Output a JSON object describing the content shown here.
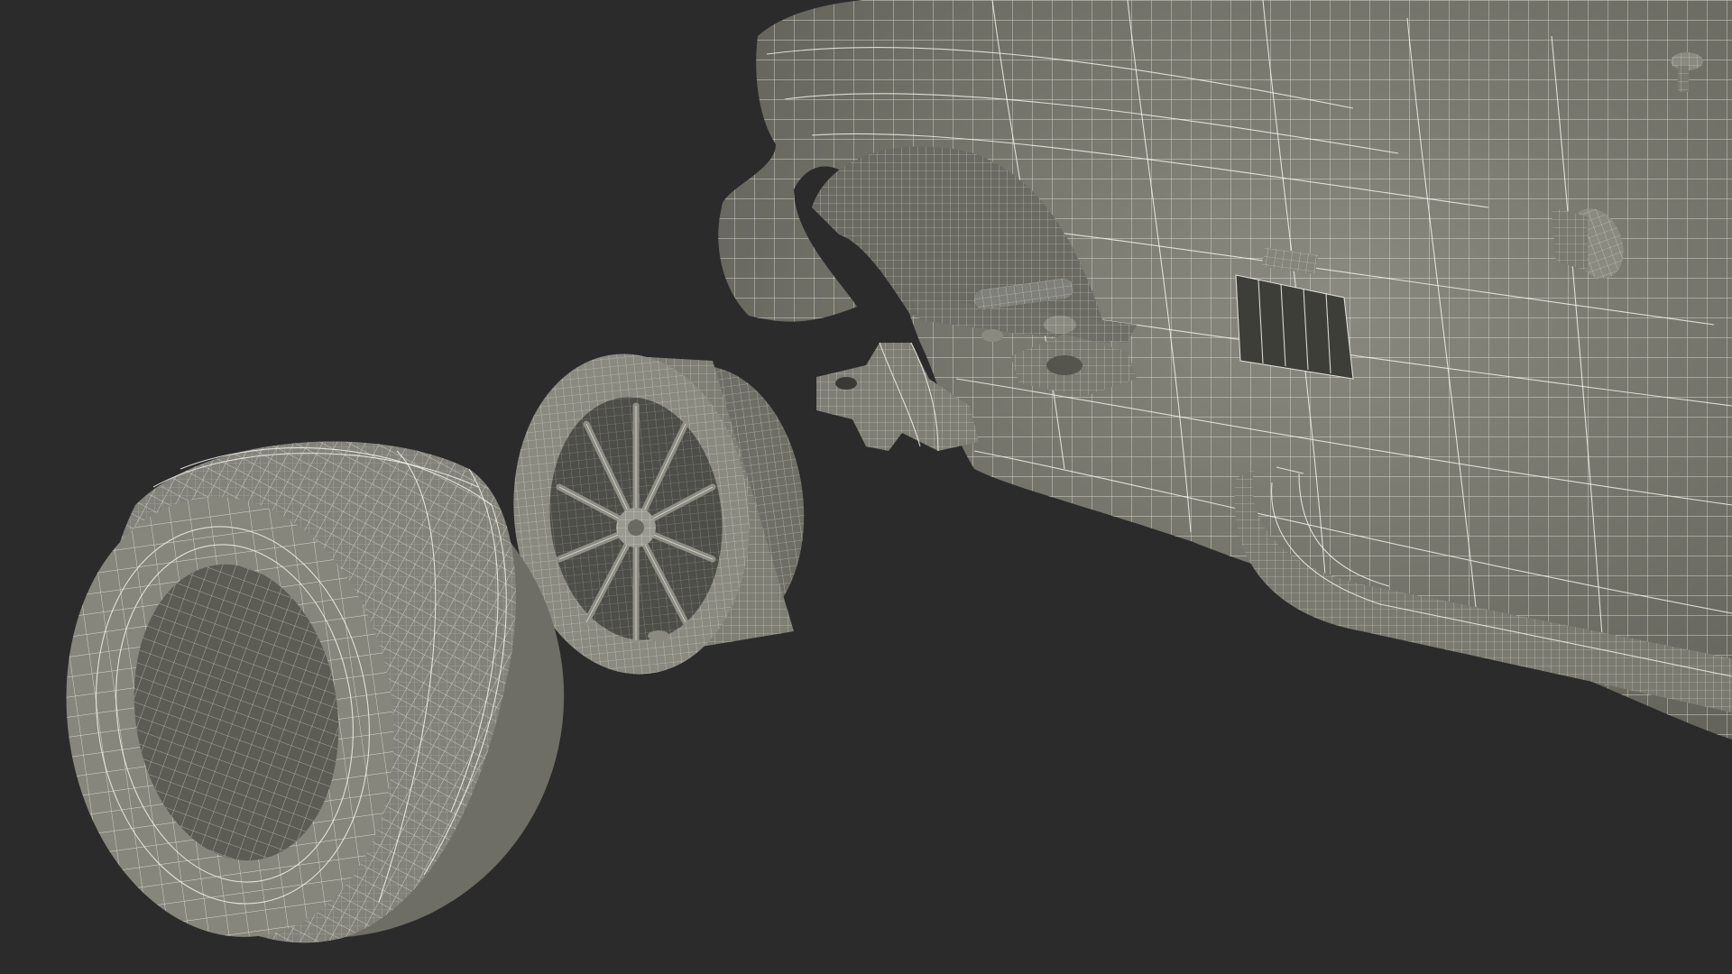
{
  "scene": {
    "background_color": "#2b2b2b",
    "surface_color": "#7a7a70",
    "surface_dark_color": "#55554d",
    "wire_color": "#f2f1ea"
  }
}
